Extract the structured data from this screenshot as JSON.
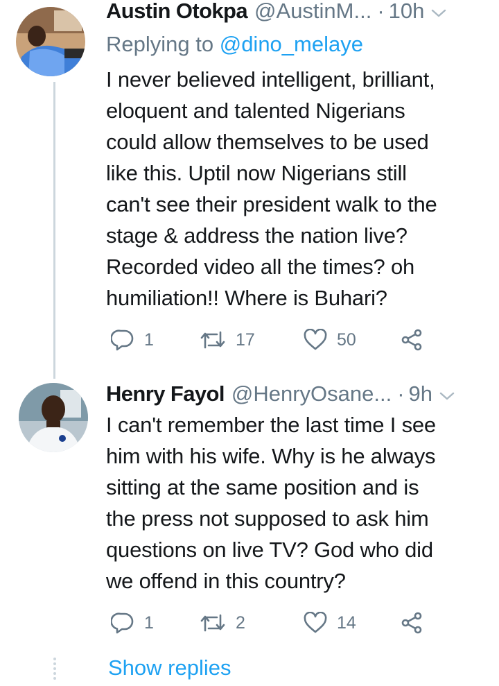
{
  "tweets": [
    {
      "name": "Austin Otokpa",
      "handle": "@AustinM...",
      "separator": "·",
      "time": "10h",
      "replying_prefix": "Replying to",
      "replying_mention": "@dino_melaye",
      "text": "I never believed intelligent, brilliant,\neloquent and talented Nigerians\ncould allow themselves to be used\nlike this. Uptil now Nigerians still\ncan't see their president walk to the\nstage & address the nation live?\nRecorded video all the times? oh\nhumiliation!! Where is Buhari?",
      "replies": "1",
      "retweets": "17",
      "likes": "50"
    },
    {
      "name": "Henry Fayol",
      "handle": "@HenryOsane...",
      "separator": "·",
      "time": "9h",
      "text": "I can't remember the last time I see\nhim with his wife.  Why is he always\nsitting at the same position and is\nthe press not supposed to ask him\nquestions on live TV? God who did\nwe offend in this country?",
      "replies": "1",
      "retweets": "2",
      "likes": "14"
    }
  ],
  "show_replies": "Show replies",
  "colors": {
    "link": "#1da1f2",
    "muted": "#657786",
    "text": "#14171a",
    "thread_line": "#ccd6dd"
  },
  "icons": [
    "chevron-down-icon",
    "reply-icon",
    "retweet-icon",
    "like-icon",
    "share-icon"
  ]
}
